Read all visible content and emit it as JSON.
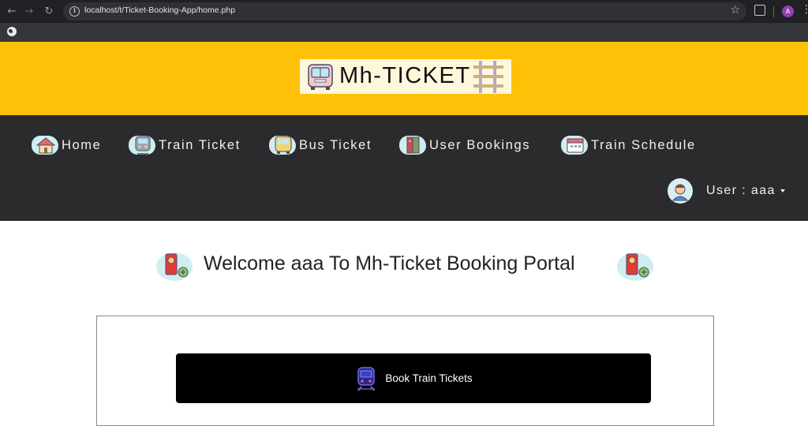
{
  "browser": {
    "url": "localhost/t/Ticket-Booking-App/home.php",
    "profile_initial": "A"
  },
  "brand": {
    "name": "Mh-TICKET",
    "accent_color": "#ffc107",
    "nav_color": "#2b2b2d"
  },
  "nav": {
    "items": [
      {
        "label": "Home",
        "icon": "home-icon"
      },
      {
        "label": "Train Ticket",
        "icon": "train-icon"
      },
      {
        "label": "Bus Ticket",
        "icon": "bus-icon"
      },
      {
        "label": "User Bookings",
        "icon": "bookings-icon"
      },
      {
        "label": "Train Schedule",
        "icon": "schedule-icon"
      }
    ],
    "user_label": "User : aaa"
  },
  "main": {
    "welcome": "Welcome aaa To Mh-Ticket Booking Portal",
    "book_button": "Book Train Tickets"
  }
}
